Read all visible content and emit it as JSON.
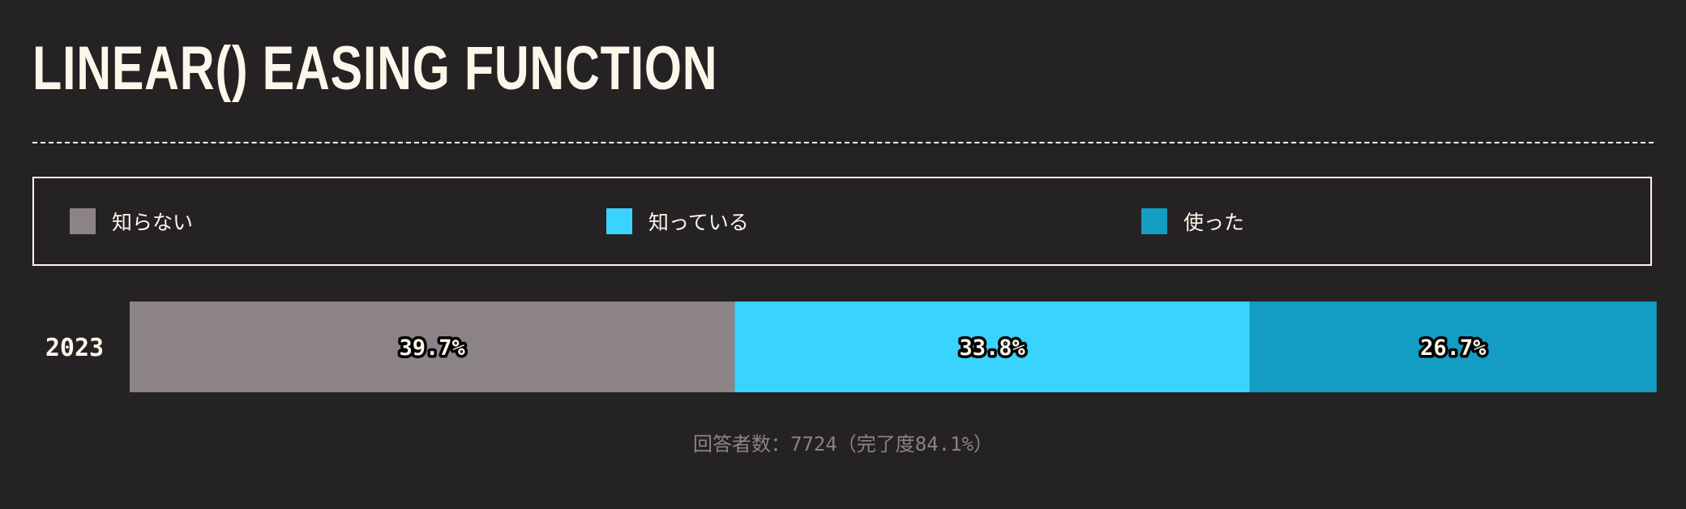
{
  "page": {
    "title": "LINEAR() EASING FUNCTION",
    "footnote": {
      "prefix": "回答者数：",
      "respondents": "7724",
      "middle": "（完了度",
      "completion": "84.1%",
      "suffix": "）"
    }
  },
  "chart_data": {
    "type": "bar",
    "orientation": "horizontal",
    "stacked": true,
    "normalized": true,
    "categories": [
      "2023"
    ],
    "series": [
      {
        "name": "知らない",
        "color": "#8b8386",
        "values": [
          39.7
        ]
      },
      {
        "name": "知っている",
        "color": "#3ad3fd",
        "values": [
          33.8
        ]
      },
      {
        "name": "使った",
        "color": "#139dc3",
        "values": [
          26.7
        ]
      }
    ],
    "value_labels": [
      [
        "39.7%",
        "33.8%",
        "26.7%"
      ]
    ],
    "xlim": [
      0,
      100
    ],
    "legend_position": "top",
    "grid": false
  }
}
